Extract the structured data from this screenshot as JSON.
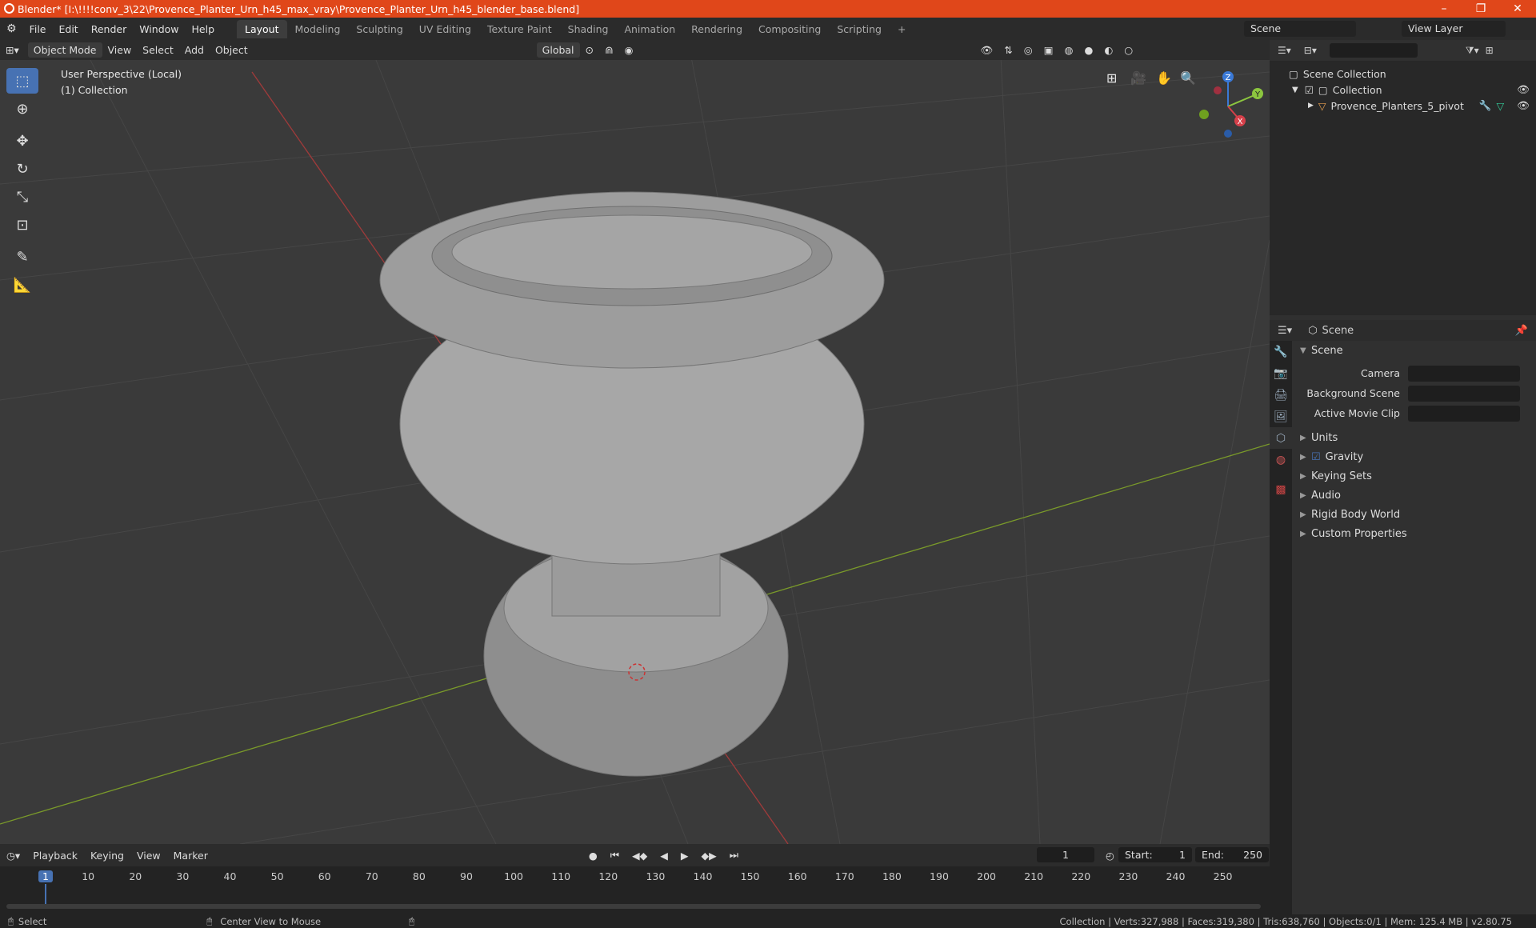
{
  "window": {
    "title": "Blender* [I:\\!!!!conv_3\\22\\Provence_Planter_Urn_h45_max_vray\\Provence_Planter_Urn_h45_blender_base.blend]"
  },
  "menus": [
    "File",
    "Edit",
    "Render",
    "Window",
    "Help"
  ],
  "workspaces": [
    "Layout",
    "Modeling",
    "Sculpting",
    "UV Editing",
    "Texture Paint",
    "Shading",
    "Animation",
    "Rendering",
    "Compositing",
    "Scripting"
  ],
  "scene_name": "Scene",
  "view_layer": "View Layer",
  "viewport": {
    "mode": "Object Mode",
    "menus": [
      "View",
      "Select",
      "Add",
      "Object"
    ],
    "orientation": "Global",
    "perspective": "User Perspective (Local)",
    "collection": "(1) Collection",
    "gizmo_axes": [
      "Z",
      "Y",
      "X"
    ]
  },
  "outliner": {
    "root": "Scene Collection",
    "collection": "Collection",
    "object": "Provence_Planters_5_pivot"
  },
  "properties": {
    "header": "Scene",
    "section": "Scene",
    "fields": [
      "Camera",
      "Background Scene",
      "Active Movie Clip"
    ],
    "panels": [
      "Units",
      "Gravity",
      "Keying Sets",
      "Audio",
      "Rigid Body World",
      "Custom Properties"
    ]
  },
  "timeline": {
    "menus": [
      "Playback",
      "Keying",
      "View",
      "Marker"
    ],
    "current_frame": "1",
    "start_label": "Start:",
    "start": "1",
    "end_label": "End:",
    "end": "250",
    "ticks": [
      "1",
      "10",
      "20",
      "30",
      "40",
      "50",
      "60",
      "70",
      "80",
      "90",
      "100",
      "110",
      "120",
      "130",
      "140",
      "150",
      "160",
      "170",
      "180",
      "190",
      "200",
      "210",
      "220",
      "230",
      "240",
      "250"
    ]
  },
  "status": {
    "left": "Select",
    "middle": "Center View to Mouse",
    "right": "Collection | Verts:327,988 | Faces:319,380 | Tris:638,760 | Objects:0/1 | Mem: 125.4 MB | v2.80.75"
  },
  "colors": {
    "titlebar": "#e0471a",
    "accent": "#4772b3",
    "x_axis": "#d6404a",
    "y_axis": "#8cc63f",
    "z_axis": "#3a79d6"
  }
}
